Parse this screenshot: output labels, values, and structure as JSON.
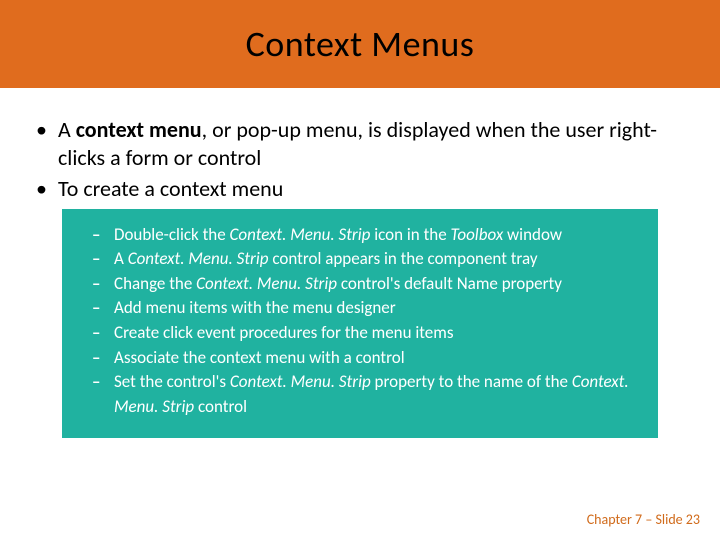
{
  "title": "Context Menus",
  "bullets": {
    "b1_pre": "A ",
    "b1_bold": "context menu",
    "b1_post": ", or pop-up menu, is displayed when the user right-clicks a form or control",
    "b2": "To create a context menu"
  },
  "sub": {
    "s1_a": "Double-click the ",
    "s1_i1": "Context. Menu. Strip",
    "s1_b": " icon in the ",
    "s1_i2": "Toolbox",
    "s1_c": " window",
    "s2_a": "A ",
    "s2_i1": "Context. Menu. Strip",
    "s2_b": " control appears in the component tray",
    "s3_a": "Change the ",
    "s3_i1": "Context. Menu. Strip",
    "s3_b": " control's default Name property",
    "s4": "Add menu items with the menu designer",
    "s5": "Create click event procedures for the menu items",
    "s6": "Associate the context menu with a control",
    "s7_a": "Set the control's ",
    "s7_i1": "Context. Menu. Strip",
    "s7_b": " property to the name of the ",
    "s7_i2": "Context. Menu. Strip",
    "s7_c": " control"
  },
  "footer": "Chapter 7 – Slide 23"
}
